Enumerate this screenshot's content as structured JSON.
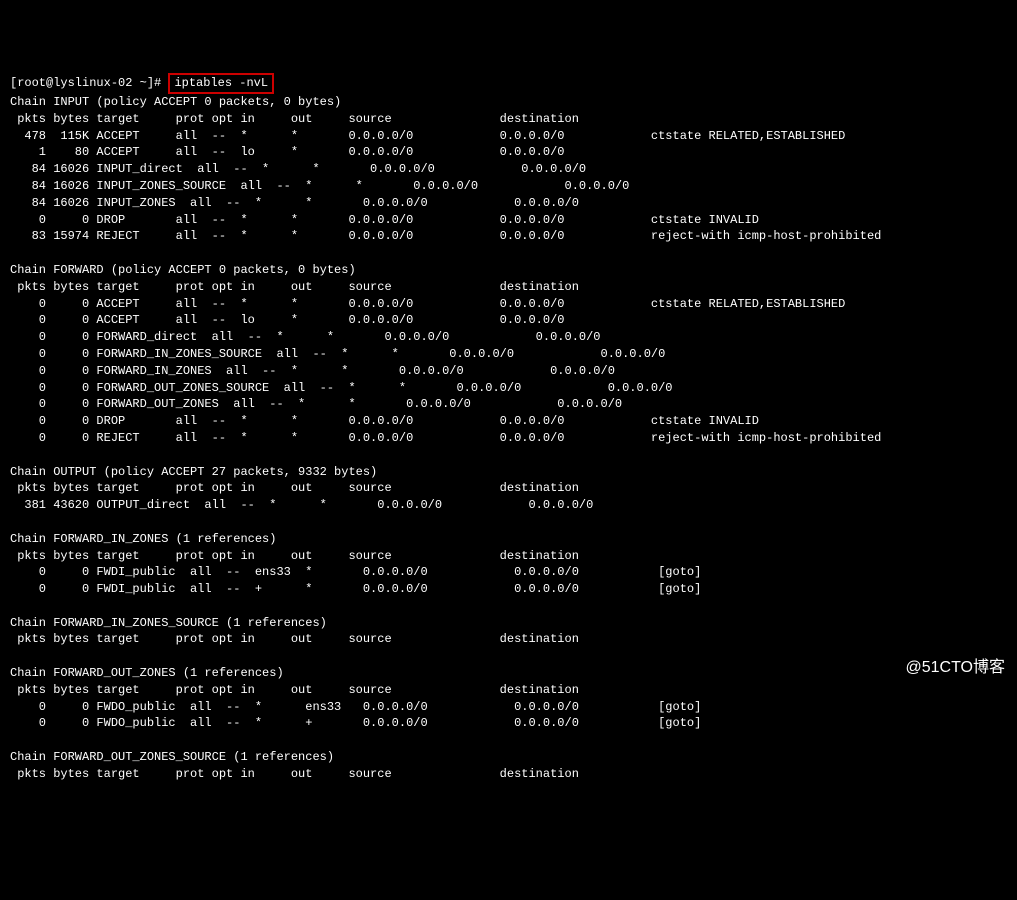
{
  "prompt": {
    "user_host": "[root@lyslinux-02 ~]#",
    "command": "iptables -nvL"
  },
  "chains": [
    {
      "name": "INPUT",
      "policy": "ACCEPT",
      "packets": "0",
      "bytes": "0 bytes",
      "header": " pkts bytes target     prot opt in     out     source               destination",
      "rules": [
        "  478  115K ACCEPT     all  --  *      *       0.0.0.0/0            0.0.0.0/0            ctstate RELATED,ESTABLISHED",
        "    1    80 ACCEPT     all  --  lo     *       0.0.0.0/0            0.0.0.0/0",
        "   84 16026 INPUT_direct  all  --  *      *       0.0.0.0/0            0.0.0.0/0",
        "   84 16026 INPUT_ZONES_SOURCE  all  --  *      *       0.0.0.0/0            0.0.0.0/0",
        "   84 16026 INPUT_ZONES  all  --  *      *       0.0.0.0/0            0.0.0.0/0",
        "    0     0 DROP       all  --  *      *       0.0.0.0/0            0.0.0.0/0            ctstate INVALID",
        "   83 15974 REJECT     all  --  *      *       0.0.0.0/0            0.0.0.0/0            reject-with icmp-host-prohibited"
      ]
    },
    {
      "name": "FORWARD",
      "policy": "ACCEPT",
      "packets": "0",
      "bytes": "0 bytes",
      "header": " pkts bytes target     prot opt in     out     source               destination",
      "rules": [
        "    0     0 ACCEPT     all  --  *      *       0.0.0.0/0            0.0.0.0/0            ctstate RELATED,ESTABLISHED",
        "    0     0 ACCEPT     all  --  lo     *       0.0.0.0/0            0.0.0.0/0",
        "    0     0 FORWARD_direct  all  --  *      *       0.0.0.0/0            0.0.0.0/0",
        "    0     0 FORWARD_IN_ZONES_SOURCE  all  --  *      *       0.0.0.0/0            0.0.0.0/0",
        "    0     0 FORWARD_IN_ZONES  all  --  *      *       0.0.0.0/0            0.0.0.0/0",
        "    0     0 FORWARD_OUT_ZONES_SOURCE  all  --  *      *       0.0.0.0/0            0.0.0.0/0",
        "    0     0 FORWARD_OUT_ZONES  all  --  *      *       0.0.0.0/0            0.0.0.0/0",
        "    0     0 DROP       all  --  *      *       0.0.0.0/0            0.0.0.0/0            ctstate INVALID",
        "    0     0 REJECT     all  --  *      *       0.0.0.0/0            0.0.0.0/0            reject-with icmp-host-prohibited"
      ]
    },
    {
      "name": "OUTPUT",
      "policy": "ACCEPT",
      "packets": "27",
      "bytes": "9332 bytes",
      "header": " pkts bytes target     prot opt in     out     source               destination",
      "rules": [
        "  381 43620 OUTPUT_direct  all  --  *      *       0.0.0.0/0            0.0.0.0/0"
      ]
    },
    {
      "name": "FORWARD_IN_ZONES",
      "refs": "(1 references)",
      "header": " pkts bytes target     prot opt in     out     source               destination",
      "rules": [
        "    0     0 FWDI_public  all  --  ens33  *       0.0.0.0/0            0.0.0.0/0           [goto]",
        "    0     0 FWDI_public  all  --  +      *       0.0.0.0/0            0.0.0.0/0           [goto]"
      ]
    },
    {
      "name": "FORWARD_IN_ZONES_SOURCE",
      "refs": "(1 references)",
      "header": " pkts bytes target     prot opt in     out     source               destination",
      "rules": []
    },
    {
      "name": "FORWARD_OUT_ZONES",
      "refs": "(1 references)",
      "header": " pkts bytes target     prot opt in     out     source               destination",
      "rules": [
        "    0     0 FWDO_public  all  --  *      ens33   0.0.0.0/0            0.0.0.0/0           [goto]",
        "    0     0 FWDO_public  all  --  *      +       0.0.0.0/0            0.0.0.0/0           [goto]"
      ]
    },
    {
      "name": "FORWARD_OUT_ZONES_SOURCE",
      "refs": "(1 references)",
      "header": " pkts bytes target     prot opt in     out     source               destination",
      "rules": []
    }
  ],
  "watermark": "@51CTO博客"
}
